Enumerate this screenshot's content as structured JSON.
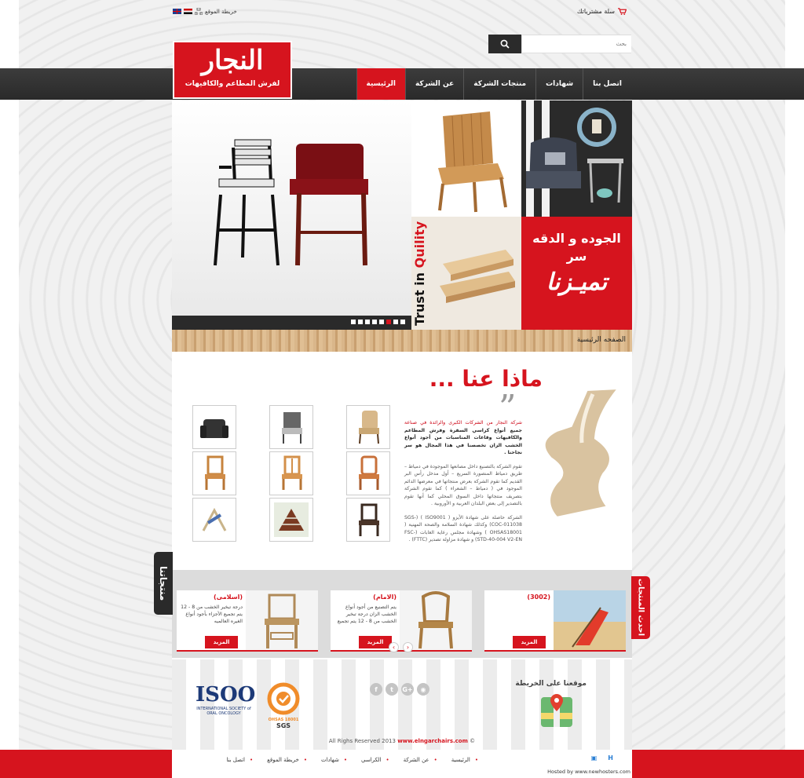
{
  "topbar": {
    "cart_label": "سلة مشترياتك",
    "sitemap_label": "خريطة الموقع"
  },
  "search": {
    "placeholder": "بحث"
  },
  "logo": {
    "title": "النجار",
    "subtitle": "لفرش المطاعم والكافيهات"
  },
  "nav": {
    "items": [
      {
        "label": "الرئيسية",
        "active": true
      },
      {
        "label": "عن الشركة"
      },
      {
        "label": "منتجات الشركة"
      },
      {
        "label": "شهادات"
      },
      {
        "label": "اتصل بنا"
      }
    ]
  },
  "slider": {
    "quality_line1": "الجوده و الدقه",
    "quality_line2": "سر",
    "quality_line3": "تميـزنا",
    "trust_text_1": "Trust in",
    "trust_text_2": "Quility",
    "dots_total": 8,
    "dot_active": 6
  },
  "breadcrumb": "الصفحه الرئيسية",
  "about": {
    "title": "ماذا عنا ...",
    "quote_mark": "”",
    "para1_red": "شركة النجار من الشركات الكبرى والرائدة في صناعة",
    "para1_bold": "جميع أنواع كراسي السفرة وفرش المطاعم والكافيهات وقاعات المناسبات من أجود أنواع الخشب الزان تخصصنا في هذا المجال هو سر نجاحنا .",
    "para2": "تقوم الشركة بالتصنيع داخل مصانعها الموجودة في دمياط – طريق دمياط المنصورة السريع – أول مدخل رأس البر القديم كما تقوم الشركة بعرض منتجاتها في معرضها الدائم الموجود في ( دمياط – الشعراء ) كما تقوم الشركة بتصريف منتجاتها داخل السوق المحلي كما أنها تقوم بالتصدير إلى بعض البلدان العربية و الأوروبية .",
    "para3": "الشركة حاصلة على شهادة الأيزو ( ISO9001 ) (SGS-COC-011038) وكذلك شهادة السلامة والصحة المهنية ( OHSAS18001 ) وشهادة مجلس رعاية الغابات (FSC-STD-40-004 V2-EN) و شهادة مزاولة تصدير (FTTC) ."
  },
  "tabs": {
    "products": "منتجاتنا",
    "latest": "احدث المنتجات"
  },
  "featured": {
    "more_label": "المزيد",
    "cards": [
      {
        "title": "(3002)",
        "desc": ""
      },
      {
        "title": "(الامام)",
        "desc": "يتم التصنيع من أجود أنواع الخشب الزان درجة تبخير الخشب من 8 - 12 يتم تجميع"
      },
      {
        "title": "(اسلامى)",
        "desc": "درجة تبخير الخشب من 8 - 12 يتم تجميع الأجزاء بأجود أنواع الغيره العالميه"
      }
    ]
  },
  "footer": {
    "map_title": "موقعنا على الخريطة",
    "copyright_prefix": "All Righs Reserved 2013",
    "copyright_site": "www.elngarchairs.com",
    "copyright_suffix": "©",
    "social": [
      "f",
      "t",
      "G+",
      "rss"
    ],
    "iso_text": "ISOO",
    "iso_sub": "INTERNATIONAL SOCIETY of ORAL ONCOLOGY",
    "sgs_text": "SGS",
    "sgs_sub": "OHSAS 18001"
  },
  "bottom_nav": {
    "links": [
      "الرئيسية",
      "عن الشركة",
      "الكراسي",
      "شهادات",
      "خريطة الموقع",
      "اتصل بنا"
    ],
    "hosted": "Hosted by www.newhosters.com"
  },
  "colors": {
    "accent": "#d6141e",
    "nav_dark": "#2f2f2f"
  }
}
